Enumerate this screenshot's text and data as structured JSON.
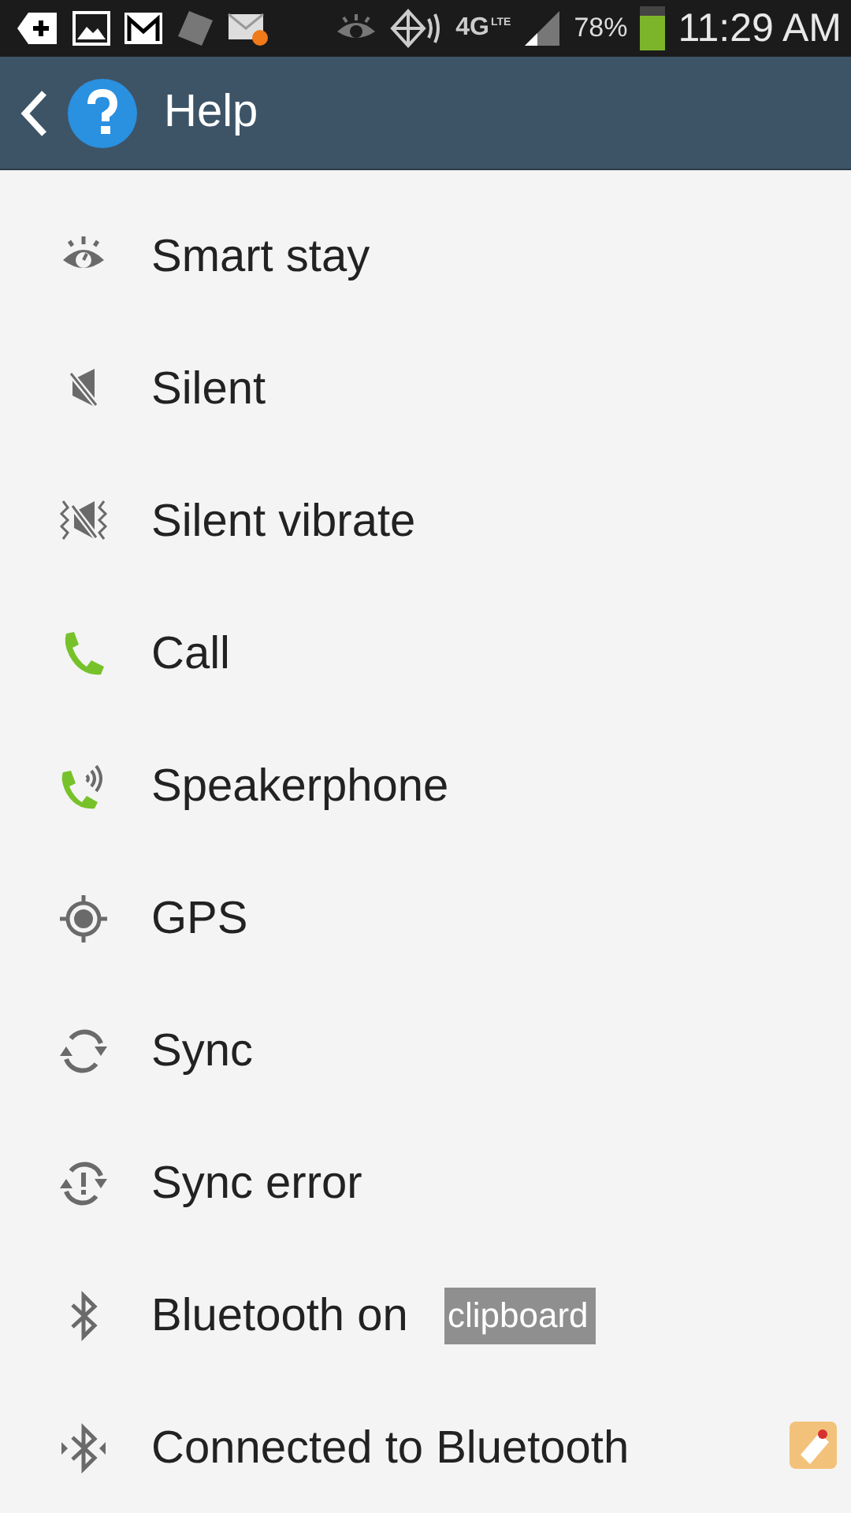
{
  "status_bar": {
    "network": "4G",
    "network_sub": "LTE",
    "battery_text": "78%",
    "battery": {
      "level": 0.78
    },
    "time": "11:29 AM"
  },
  "app_bar": {
    "title": "Help"
  },
  "items": [
    {
      "label": "Smart stay"
    },
    {
      "label": "Silent"
    },
    {
      "label": "Silent vibrate"
    },
    {
      "label": "Call"
    },
    {
      "label": "Speakerphone"
    },
    {
      "label": "GPS"
    },
    {
      "label": "Sync"
    },
    {
      "label": "Sync error"
    },
    {
      "label": "Bluetooth on"
    },
    {
      "label": "Connected to Bluetooth"
    }
  ],
  "toast": {
    "text": "clipboard"
  }
}
